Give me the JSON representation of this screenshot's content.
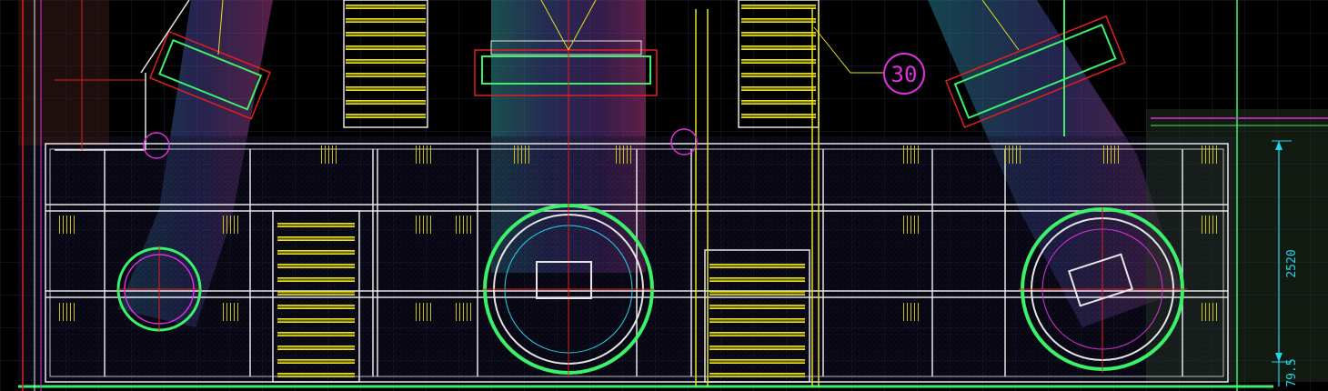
{
  "viewer": {
    "background": "#000000",
    "grid_color": "#1b2230",
    "colors": {
      "yellow": "#e8e020",
      "white": "#e6e6e6",
      "red": "#e02020",
      "green": "#3df06a",
      "cyan": "#22d6e6",
      "magenta": "#e030e0",
      "purple": "#5a3aa8",
      "pink": "#f05aa0"
    }
  },
  "annotations": {
    "callout_number": "30",
    "dimension_upper": "2520",
    "dimension_lower": "79.5"
  }
}
